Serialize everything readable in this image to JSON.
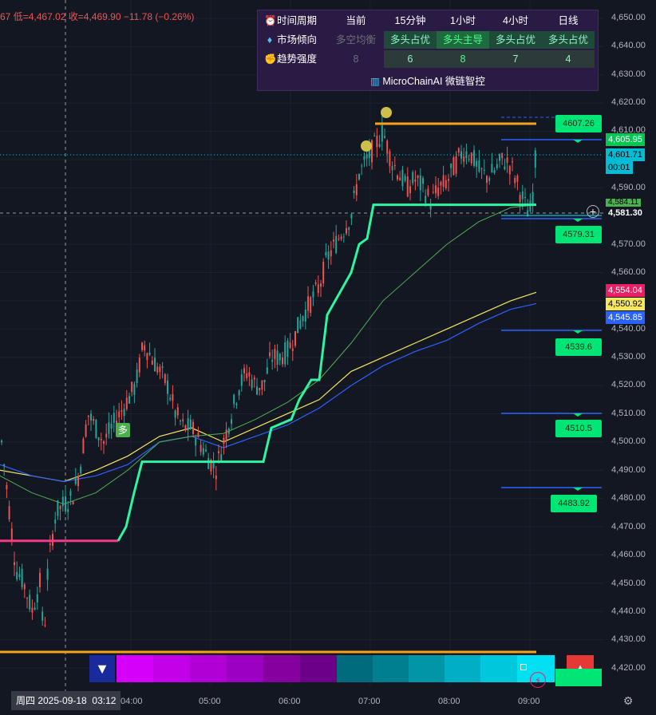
{
  "ohlc": {
    "open_tail": "67",
    "low_label": "低=",
    "low_value": "4,467.02",
    "close_label": "收=",
    "close_value": "4,469.90",
    "change": "−11.78 (−0.26%)"
  },
  "panel": {
    "header": {
      "icon": "alarm-clock-icon",
      "label": "时间周期",
      "cols": [
        "当前",
        "15分钟",
        "1小时",
        "4小时",
        "日线"
      ]
    },
    "trend": {
      "icon": "tag-icon",
      "label": "市场倾向",
      "cols": [
        "多空均衡",
        "多头占优",
        "多头主导",
        "多头占优",
        "多头占优"
      ]
    },
    "strength": {
      "icon": "flexed-biceps-icon",
      "label": "趋势强度",
      "cols": [
        "8",
        "6",
        "8",
        "7",
        "4"
      ]
    },
    "brand": "MicroChainAI 微链智控",
    "brand_icon": "bar-chart-icon"
  },
  "y_axis": [
    "4,650.00",
    "4,640.00",
    "4,630.00",
    "4,620.00",
    "4,610.00",
    "4,590.00",
    "4,570.00",
    "4,560.00",
    "4,540.00",
    "4,530.00",
    "4,520.00",
    "4,510.00",
    "4,500.00",
    "4,490.00",
    "4,480.00",
    "4,470.00",
    "4,460.00",
    "4,450.00",
    "4,440.00",
    "4,430.00",
    "4,420.00"
  ],
  "x_axis": [
    "04:00",
    "05:00",
    "06:00",
    "07:00",
    "08:00",
    "09:00"
  ],
  "date_label": "周四 2025-09-18",
  "time_label": "03:12",
  "price_tags": {
    "tag_4605": "4,605.95",
    "tag_4601": "4,601.71",
    "tag_countdown": "00:01",
    "tag_4584": "4,584.11",
    "tag_4581": "4,581.30",
    "tag_4554": "4,554.04",
    "tag_4550": "4,550.92",
    "tag_4545": "4,545.85"
  },
  "levels": [
    "4607.26",
    "4579.31",
    "4539.6",
    "4510.5",
    "4483.92"
  ],
  "signal_label": "多",
  "colors": {
    "up": "#26a69a",
    "down": "#ef5350",
    "trail": "#2ef5a0",
    "trail_down": "#f23a8a",
    "orange": "#f7a21b",
    "blue": "#2962ff",
    "yellow": "#f5e65c",
    "green_ma": "#4caf50"
  }
}
